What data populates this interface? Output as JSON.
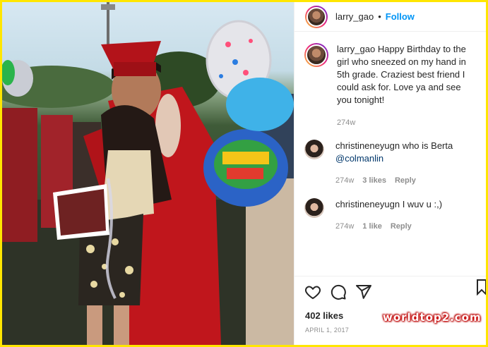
{
  "post": {
    "author": "larry_gao",
    "separator": "•",
    "follow_label": "Follow",
    "caption_user": "larry_gao",
    "caption": "Happy Birthday to the girl who sneezed on my hand in 5th grade. Craziest best friend I could ask for. Love ya and see you tonight!",
    "caption_time": "274w",
    "likes": "402 likes",
    "date": "APRIL 1, 2017"
  },
  "comments": [
    {
      "user": "christineneyugn",
      "text": "who is Berta",
      "mention": "@colmanlin",
      "time": "274w",
      "likes": "3 likes",
      "reply": "Reply"
    },
    {
      "user": "christineneyugn",
      "text": "I wuv u :,)",
      "time": "274w",
      "likes": "1 like",
      "reply": "Reply"
    }
  ],
  "watermark": "worldtop2.com",
  "icons": [
    "heart-icon",
    "comment-icon",
    "share-icon",
    "bookmark-icon"
  ],
  "colors": {
    "follow": "#0095f6",
    "border": "#ffe600",
    "gown": "#c0161c"
  }
}
